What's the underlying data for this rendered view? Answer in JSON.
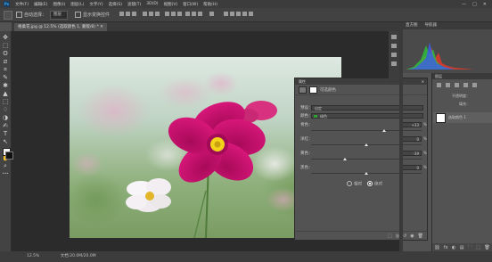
{
  "app": {
    "logo_label": "Ps"
  },
  "menu": {
    "items": [
      "文件(F)",
      "编辑(E)",
      "图像(I)",
      "图层(L)",
      "文字(Y)",
      "选择(S)",
      "滤镜(T)",
      "3D(D)",
      "视图(V)",
      "窗口(W)",
      "帮助(H)"
    ],
    "window_controls": [
      "—",
      "□",
      "✕"
    ]
  },
  "options": {
    "auto_select_label": "自动选择：",
    "auto_select_value": "图层",
    "show_transform_label": "显示变换控件"
  },
  "document": {
    "tab_title": "格桑花.jpg @ 12.5% (选取颜色 1, 蒙版/8) *  ✕"
  },
  "tools": [
    "✥",
    "⬚",
    "ʘ",
    "⧄",
    "⌗",
    "✎",
    "✱",
    "▲",
    "⬚",
    "♢",
    "◑",
    "✍",
    "T",
    "↖",
    "▭",
    "✋",
    "⌕",
    "•••"
  ],
  "properties": {
    "title": "属性",
    "close": "✕",
    "subtitle": "可选颜色",
    "preset_label": "预设：",
    "preset_value": "自定",
    "color_label": "颜色：",
    "color_value": "绿色",
    "color_swatch": "#2fa02f",
    "sliders": [
      {
        "label": "青色：",
        "value": "+33",
        "level": 33
      },
      {
        "label": "洋红：",
        "value": "0",
        "level": 0
      },
      {
        "label": "黄色：",
        "value": "-39",
        "level": -39
      },
      {
        "label": "黑色：",
        "value": "0",
        "level": 0
      }
    ],
    "percent": "%",
    "relative_label": "相对",
    "absolute_label": "绝对",
    "footer_icons": [
      "⬚",
      "◎",
      "↺",
      "◉",
      "🗑"
    ]
  },
  "histogram": {
    "tabs": [
      "直方图",
      "导航器"
    ]
  },
  "layers": {
    "tabs": "图层",
    "blend_mode": "不透明度：",
    "fill_label": "填充：",
    "layer_name": "选取颜色 1",
    "footer_icons": [
      "⛓",
      "fx",
      "◐",
      "▤",
      "🗀",
      "⬚",
      "🗑"
    ]
  },
  "status": {
    "zoom": "12.5%",
    "doc_info": "文档:20.0M/20.0M"
  },
  "colors": {
    "accent": "#31a8ff",
    "flower": "#c8106b",
    "center": "#f3d21a"
  }
}
